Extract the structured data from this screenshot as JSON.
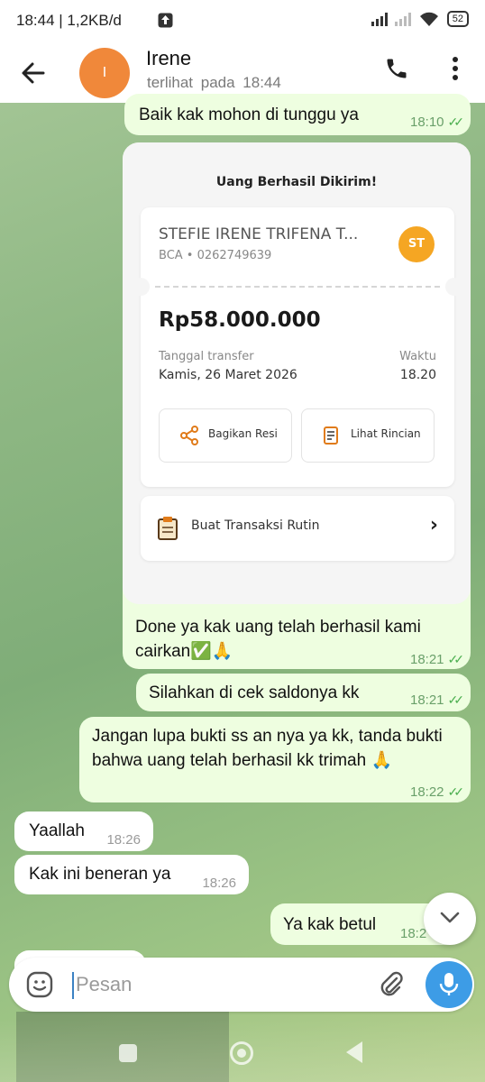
{
  "status_bar": {
    "time": "18:44 | 1,2KB/d",
    "battery": "52",
    "icons": [
      "upload-icon",
      "signal-icon",
      "wifi-icon",
      "battery-icon"
    ]
  },
  "header": {
    "avatar_letter": "I",
    "contact_name": "Irene",
    "last_seen": "terlihat pada 18:44",
    "icons": [
      "back-arrow-icon",
      "phone-icon",
      "more-vert-icon"
    ]
  },
  "messages": [
    {
      "dir": "out",
      "text": "Baik kak mohon di tunggu ya",
      "time": "18:10",
      "ticks": "✓✓"
    },
    {
      "dir": "out",
      "text": "Done ya kak uang telah berhasil kami cairkan✅🙏",
      "time": "18:21",
      "ticks": "✓✓"
    },
    {
      "dir": "out",
      "text": "Silahkan di cek saldonya kk",
      "time": "18:21",
      "ticks": "✓✓"
    },
    {
      "dir": "out",
      "text": "Jangan lupa bukti ss an nya ya kk, tanda bukti bahwa uang telah berhasil kk trimah 🙏",
      "time": "18:22",
      "ticks": "✓✓"
    },
    {
      "dir": "in",
      "text": "Yaallah",
      "time": "18:26"
    },
    {
      "dir": "in",
      "text": "Kak ini beneran ya",
      "time": "18:26"
    },
    {
      "dir": "out",
      "text": "Ya kak betul",
      "time": "18:2"
    }
  ],
  "receipt": {
    "title": "Uang Berhasil Dikirim!",
    "recipient_name": "STEFIE IRENE TRIFENA T...",
    "bank": "BCA • 0262749639",
    "avatar_initials": "ST",
    "amount": "Rp58.000.000",
    "date_label": "Tanggal transfer",
    "date_value": "Kamis, 26 Maret 2026",
    "time_label": "Waktu",
    "time_value": "18.20",
    "share_button": "Bagikan Resi",
    "details_button": "Lihat Rincian",
    "routine_label": "Buat Transaksi Rutin",
    "colors": {
      "avatar": "#f5a623",
      "icons": "#e07b1a"
    }
  },
  "composer": {
    "placeholder": "Pesan",
    "icons": [
      "emoji-icon",
      "attach-icon",
      "mic-icon"
    ]
  },
  "colors": {
    "outgoing_bubble": "#eefee0",
    "incoming_bubble": "#ffffff",
    "accent": "#3d9ce6",
    "avatar": "#f0883a",
    "tick": "#4caf50"
  }
}
